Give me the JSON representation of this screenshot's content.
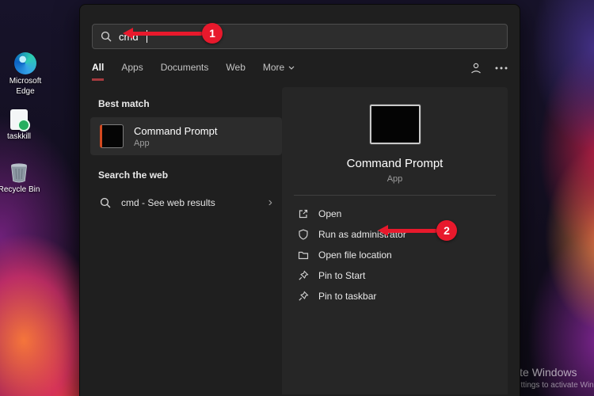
{
  "search": {
    "query": "cmd"
  },
  "tabs": {
    "items": [
      {
        "label": "All"
      },
      {
        "label": "Apps"
      },
      {
        "label": "Documents"
      },
      {
        "label": "Web"
      },
      {
        "label": "More"
      }
    ]
  },
  "left": {
    "best_match_header": "Best match",
    "app_title": "Command Prompt",
    "app_subtitle": "App",
    "web_header": "Search the web",
    "web_result": "cmd - See web results",
    "web_chevron": "›"
  },
  "preview": {
    "title": "Command Prompt",
    "subtitle": "App",
    "actions": [
      {
        "label": "Open"
      },
      {
        "label": "Run as administrator"
      },
      {
        "label": "Open file location"
      },
      {
        "label": "Pin to Start"
      },
      {
        "label": "Pin to taskbar"
      }
    ]
  },
  "annotations": {
    "step1": "1",
    "step2": "2",
    "arrow_color": "#e8192c"
  },
  "desktop": {
    "icons": [
      {
        "label": "Microsoft Edge"
      },
      {
        "label": "taskkill"
      },
      {
        "label": "Recycle Bin"
      }
    ]
  },
  "watermark": {
    "line1": "Activate Windows",
    "line2": "Go to Settings to activate Windows."
  }
}
